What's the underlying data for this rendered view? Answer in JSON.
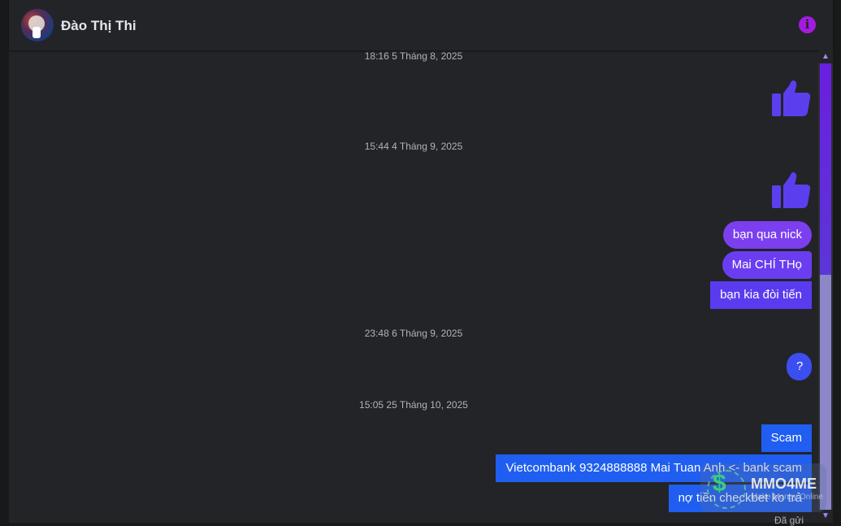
{
  "header": {
    "contact_name": "Đào Thị Thi",
    "info_icon": "info-icon"
  },
  "messages": [
    {
      "type": "timestamp",
      "text": "18:16 5 Tháng 8, 2025"
    },
    {
      "type": "like",
      "icon": "thumbs-up-icon"
    },
    {
      "type": "timestamp",
      "text": "15:44 4 Tháng 9, 2025"
    },
    {
      "type": "like",
      "icon": "thumbs-up-icon"
    },
    {
      "type": "text",
      "text": "bạn qua nick"
    },
    {
      "type": "text",
      "text": "Mai CHÍ THọ"
    },
    {
      "type": "text",
      "text": "bạn kia đòi tiến"
    },
    {
      "type": "timestamp",
      "text": "23:48 6 Tháng 9, 2025"
    },
    {
      "type": "text",
      "text": "?"
    },
    {
      "type": "timestamp",
      "text": "15:05 25 Tháng 10, 2025"
    },
    {
      "type": "text",
      "text": "Scam"
    },
    {
      "type": "text",
      "text": "Vietcombank 9324888888 Mai Tuan Anh <- bank scam"
    },
    {
      "type": "text",
      "text": "nợ tiền checkbet ko trả"
    }
  ],
  "status": {
    "sent_label": "Đã gửi"
  },
  "watermark": {
    "brand": "MMO4ME",
    "tagline": "Make Money Online"
  },
  "colors": {
    "bubble_purple": "#7b3ff0",
    "bubble_violet": "#5a3bf0",
    "bubble_blue": "#1f5ef0",
    "like_color": "#5b3fef",
    "info_icon": "#a41be0"
  }
}
